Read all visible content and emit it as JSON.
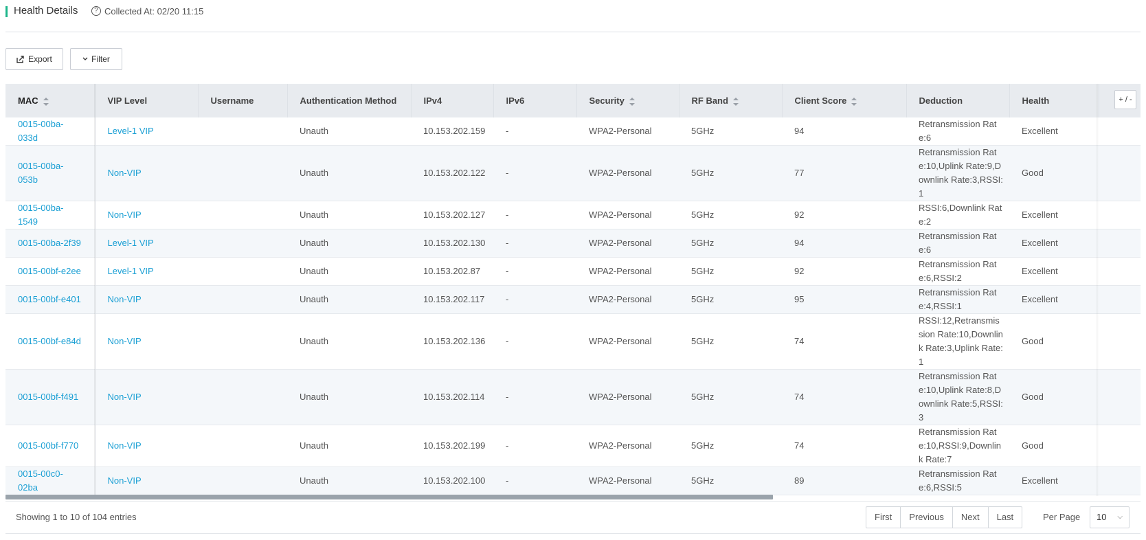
{
  "header": {
    "title": "Health Details",
    "help_icon": "?",
    "collected": "Collected At: 02/20 11:15"
  },
  "toolbar": {
    "export_label": "Export",
    "filter_label": "Filter"
  },
  "table": {
    "columns": [
      "MAC",
      "VIP Level",
      "Username",
      "Authentication Method",
      "IPv4",
      "IPv6",
      "Security",
      "RF Band",
      "Client Score",
      "Deduction",
      "Health"
    ],
    "column_toggle": "+ / -",
    "rows": [
      {
        "mac": "0015-00ba-033d",
        "vip": "Level-1 VIP",
        "username": "",
        "auth": "Unauth",
        "ipv4": "10.153.202.159",
        "ipv6": "-",
        "security": "WPA2-Personal",
        "band": "5GHz",
        "score": "94",
        "deduction": "Retransmission Rate:6",
        "health": "Excellent"
      },
      {
        "mac": "0015-00ba-053b",
        "vip": "Non-VIP",
        "username": "",
        "auth": "Unauth",
        "ipv4": "10.153.202.122",
        "ipv6": "-",
        "security": "WPA2-Personal",
        "band": "5GHz",
        "score": "77",
        "deduction": "Retransmission Rate:10,Uplink Rate:9,Downlink Rate:3,RSSI:1",
        "health": "Good"
      },
      {
        "mac": "0015-00ba-1549",
        "vip": "Non-VIP",
        "username": "",
        "auth": "Unauth",
        "ipv4": "10.153.202.127",
        "ipv6": "-",
        "security": "WPA2-Personal",
        "band": "5GHz",
        "score": "92",
        "deduction": "RSSI:6,Downlink Rate:2",
        "health": "Excellent"
      },
      {
        "mac": "0015-00ba-2f39",
        "vip": "Level-1 VIP",
        "username": "",
        "auth": "Unauth",
        "ipv4": "10.153.202.130",
        "ipv6": "-",
        "security": "WPA2-Personal",
        "band": "5GHz",
        "score": "94",
        "deduction": "Retransmission Rate:6",
        "health": "Excellent"
      },
      {
        "mac": "0015-00bf-e2ee",
        "vip": "Level-1 VIP",
        "username": "",
        "auth": "Unauth",
        "ipv4": "10.153.202.87",
        "ipv6": "-",
        "security": "WPA2-Personal",
        "band": "5GHz",
        "score": "92",
        "deduction": "Retransmission Rate:6,RSSI:2",
        "health": "Excellent"
      },
      {
        "mac": "0015-00bf-e401",
        "vip": "Non-VIP",
        "username": "",
        "auth": "Unauth",
        "ipv4": "10.153.202.117",
        "ipv6": "-",
        "security": "WPA2-Personal",
        "band": "5GHz",
        "score": "95",
        "deduction": "Retransmission Rate:4,RSSI:1",
        "health": "Excellent"
      },
      {
        "mac": "0015-00bf-e84d",
        "vip": "Non-VIP",
        "username": "",
        "auth": "Unauth",
        "ipv4": "10.153.202.136",
        "ipv6": "-",
        "security": "WPA2-Personal",
        "band": "5GHz",
        "score": "74",
        "deduction": "RSSI:12,Retransmission Rate:10,Downlink Rate:3,Uplink Rate:1",
        "health": "Good"
      },
      {
        "mac": "0015-00bf-f491",
        "vip": "Non-VIP",
        "username": "",
        "auth": "Unauth",
        "ipv4": "10.153.202.114",
        "ipv6": "-",
        "security": "WPA2-Personal",
        "band": "5GHz",
        "score": "74",
        "deduction": "Retransmission Rate:10,Uplink Rate:8,Downlink Rate:5,RSSI:3",
        "health": "Good"
      },
      {
        "mac": "0015-00bf-f770",
        "vip": "Non-VIP",
        "username": "",
        "auth": "Unauth",
        "ipv4": "10.153.202.199",
        "ipv6": "-",
        "security": "WPA2-Personal",
        "band": "5GHz",
        "score": "74",
        "deduction": "Retransmission Rate:10,RSSI:9,Downlink Rate:7",
        "health": "Good"
      },
      {
        "mac": "0015-00c0-02ba",
        "vip": "Non-VIP",
        "username": "",
        "auth": "Unauth",
        "ipv4": "10.153.202.100",
        "ipv6": "-",
        "security": "WPA2-Personal",
        "band": "5GHz",
        "score": "89",
        "deduction": "Retransmission Rate:6,RSSI:5",
        "health": "Excellent"
      }
    ]
  },
  "footer": {
    "showing": "Showing 1 to 10 of 104 entries",
    "first": "First",
    "previous": "Previous",
    "next": "Next",
    "last": "Last",
    "per_page_label": "Per Page",
    "per_page_value": "10"
  }
}
